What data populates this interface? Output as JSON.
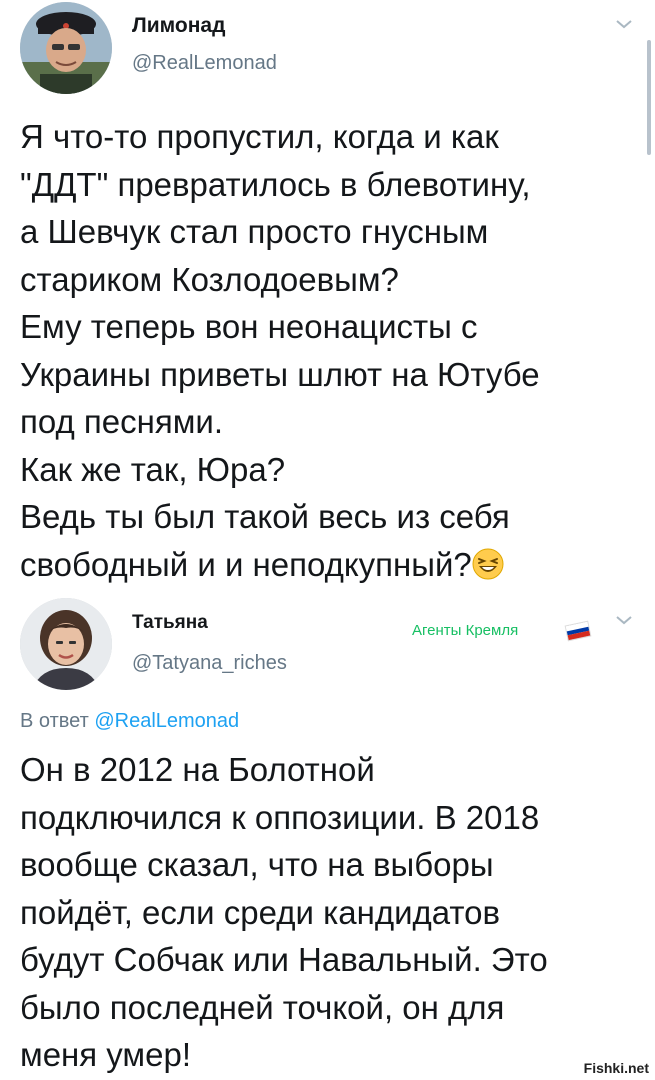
{
  "tweet1": {
    "display_name": "Лимонад",
    "handle": "@RealLemonad",
    "text_lines": [
      "Я что-то пропустил, когда и как",
      "\"ДДТ\" превратилось в блевотину,",
      "а Шевчук стал просто гнусным",
      "стариком Козлодоевым?",
      "Ему теперь вон неонацисты с",
      "Украины приветы шлют на Ютубе",
      "под песнями.",
      "Как же так, Юра?",
      "Ведь ты был такой весь из себя",
      "свободный и и неподкупный?"
    ],
    "emoji": "laughing-face"
  },
  "tweet2": {
    "display_name": "Татьяна",
    "handle": "@Tatyana_riches",
    "bio": "Агенты Кремля",
    "reply_prefix": "В ответ",
    "reply_mention": "@RealLemonad",
    "text_lines": [
      "Он в 2012 на Болотной",
      "подключился к оппозиции. В 2018",
      "вообще сказал, что на выборы",
      "пойдёт, если среди кандидатов",
      "будут Собчак или Навальный. Это",
      "было последней точкой, он для",
      "меня умер!"
    ]
  },
  "watermark": "Fishki.net",
  "colors": {
    "text": "#14171a",
    "secondary": "#657786",
    "link": "#1da1f2",
    "bio_green": "#17bf63"
  }
}
